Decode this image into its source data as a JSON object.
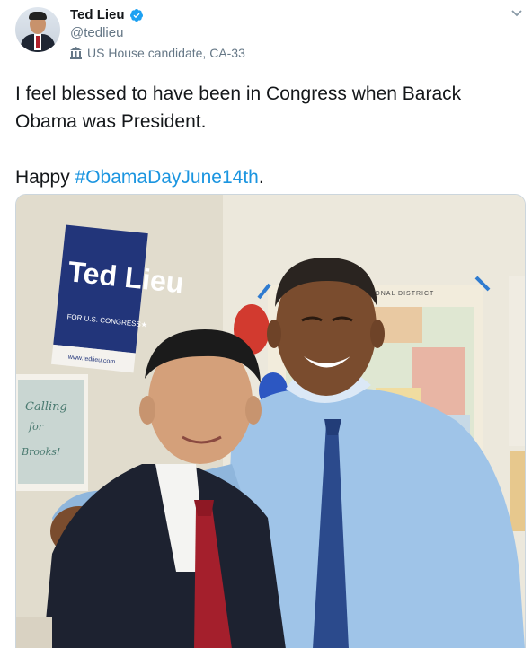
{
  "author": {
    "display_name": "Ted Lieu",
    "handle": "@tedlieu",
    "label": "US House candidate, CA-33",
    "verified_color": "#1da1f2"
  },
  "tweet": {
    "text_line1": "I feel blessed to have been in Congress when Barack",
    "text_line2": "Obama was President.",
    "happy": "Happy ",
    "hashtag": "#ObamaDayJune14th",
    "period": "."
  },
  "photo": {
    "sign": {
      "line1": "Ted Lieu",
      "line2": "FOR U.S. CONGRESS★",
      "url": "www.tedlieu.com"
    },
    "map_label": "SSIONAL DISTRICT",
    "poster_text": {
      "line1": "Calling",
      "line2": "for",
      "line3": "Brooks!"
    }
  },
  "colors": {
    "accent": "#1b95e0",
    "text": "#14171a",
    "secondary": "#657786"
  }
}
